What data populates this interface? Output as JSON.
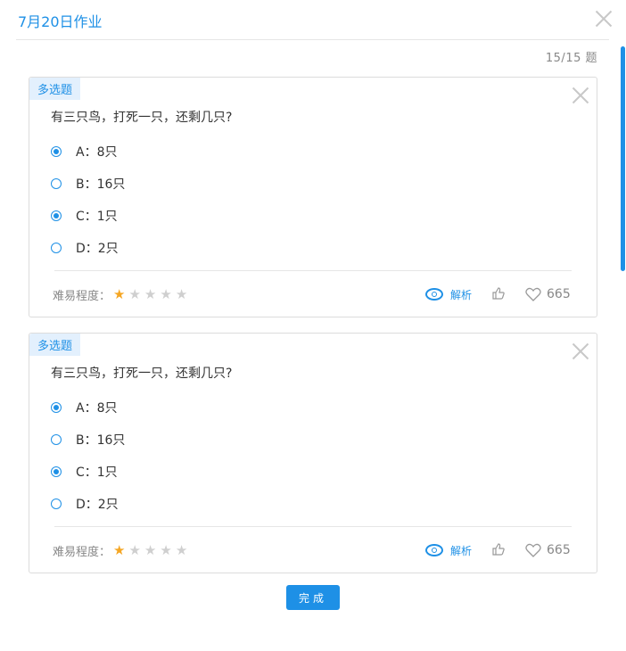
{
  "header": {
    "title": "7月20日作业",
    "counter": "15/15 题"
  },
  "cards": [
    {
      "tag": "多选题",
      "question": "有三只鸟，打死一只，还剩几只?",
      "options": [
        {
          "label": "A：8只",
          "checked": true
        },
        {
          "label": "B：16只",
          "checked": false
        },
        {
          "label": "C：1只",
          "checked": true
        },
        {
          "label": "D：2只",
          "checked": false
        }
      ],
      "difficulty_label": "难易程度：",
      "difficulty_stars": 1,
      "difficulty_max": 5,
      "analysis_label": "解析",
      "like_count": "665"
    },
    {
      "tag": "多选题",
      "question": "有三只鸟，打死一只，还剩几只?",
      "options": [
        {
          "label": "A：8只",
          "checked": true
        },
        {
          "label": "B：16只",
          "checked": false
        },
        {
          "label": "C：1只",
          "checked": true
        },
        {
          "label": "D：2只",
          "checked": false
        }
      ],
      "difficulty_label": "难易程度：",
      "difficulty_stars": 1,
      "difficulty_max": 5,
      "analysis_label": "解析",
      "like_count": "665"
    }
  ],
  "done_label": "完成",
  "colors": {
    "accent": "#1e90e6",
    "star_on": "#f5a623",
    "star_off": "#cfcfcf"
  }
}
